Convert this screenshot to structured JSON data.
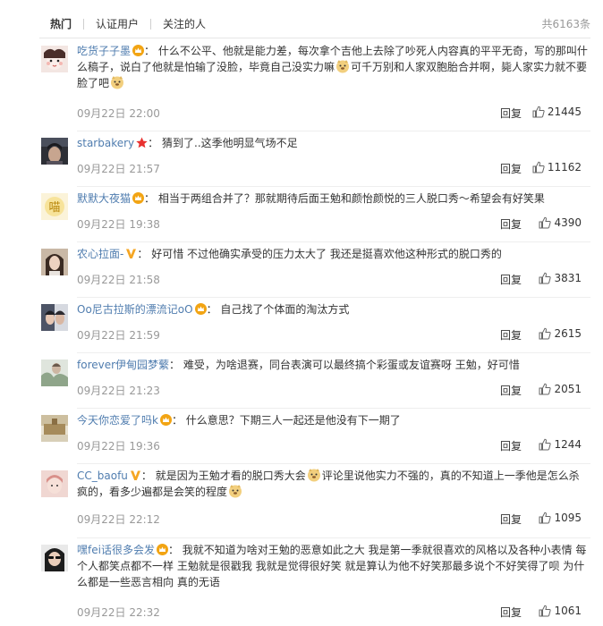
{
  "tabs": [
    {
      "label": "热门",
      "active": true
    },
    {
      "label": "认证用户",
      "active": false
    },
    {
      "label": "关注的人",
      "active": false
    }
  ],
  "total": "共6163条",
  "reply_label": "回复",
  "comments": [
    {
      "user": "吃货子子墨",
      "badge": "crown",
      "text_parts": [
        "什么不公平、他就是能力差，每次拿个吉他上去除了吵死人内容真的平平无奇，写的那叫什么稿子，说白了他就是怕输了没脸，毕竟自己没实力嘛",
        "可千万别和人家双胞胎合并啊，毙人家实力就不要脸了吧"
      ],
      "time": "09月22日 22:00",
      "likes": "21445"
    },
    {
      "user": "starbakery",
      "badge": "star",
      "text_parts": [
        "猜到了..这季他明显气场不足"
      ],
      "time": "09月22日 21:57",
      "likes": "11162"
    },
    {
      "user": "默默大夜猫",
      "badge": "crown",
      "text_parts": [
        "相当于两组合并了？那就期待后面王勉和颜怡颜悦的三人脱口秀～希望会有好笑果"
      ],
      "time": "09月22日 19:38",
      "likes": "4390"
    },
    {
      "user": "农心拉面-",
      "badge": "v",
      "text_parts": [
        "好可惜 不过他确实承受的压力太大了 我还是挺喜欢他这种形式的脱口秀的"
      ],
      "time": "09月22日 21:58",
      "likes": "3831"
    },
    {
      "user": "Oo尼古拉斯的漂流记oO",
      "badge": "crown",
      "text_parts": [
        "自己找了个体面的淘汰方式"
      ],
      "time": "09月22日 21:59",
      "likes": "2615"
    },
    {
      "user": "forever伊甸园梦蘩",
      "badge": "",
      "text_parts": [
        "难受，为啥退赛，同台表演可以最终搞个彩蛋或友谊赛呀 王勉，好可惜"
      ],
      "time": "09月22日 21:23",
      "likes": "2051"
    },
    {
      "user": "今天你恋爱了吗k",
      "badge": "crown",
      "text_parts": [
        "什么意思？下期三人一起还是他没有下一期了"
      ],
      "time": "09月22日 19:36",
      "likes": "1244"
    },
    {
      "user": "CC_baofu",
      "badge": "v",
      "text_parts": [
        "就是因为王勉才看的脱口秀大会",
        "评论里说他实力不强的，真的不知道上一季他是怎么杀疯的，看多少遍都是会笑的程度"
      ],
      "time": "09月22日 22:12",
      "likes": "1095"
    },
    {
      "user": "嘿fei话很多会发",
      "badge": "crown",
      "text_parts": [
        "我就不知道为啥对王勉的恶意如此之大 我是第一季就很喜欢的风格以及各种小表情 每个人都笑点都不一样 王勉就是很戳我 我就是觉得很好笑 就是算认为他不好笑那最多说个不好笑得了呗 为什么都是一些恶言相向 真的无语"
      ],
      "time": "09月22日 22:32",
      "likes": "1061"
    }
  ],
  "colors": {
    "link": "#507daf",
    "meta": "#999999",
    "text": "#333333",
    "divider": "#eeeeee",
    "star": "#e8312f",
    "v_badge": "#f5a623"
  }
}
